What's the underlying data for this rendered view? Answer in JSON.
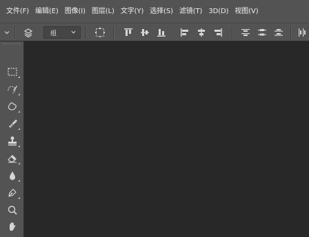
{
  "menubar": {
    "items": [
      {
        "label": "文件(F)"
      },
      {
        "label": "编辑(E)"
      },
      {
        "label": "图像(I)"
      },
      {
        "label": "图层(L)"
      },
      {
        "label": "文字(Y)"
      },
      {
        "label": "选择(S)"
      },
      {
        "label": "滤镜(T)"
      },
      {
        "label": "3D(D)"
      },
      {
        "label": "视图(V)"
      }
    ]
  },
  "options_bar": {
    "auto_select_target": {
      "value": "组"
    }
  },
  "toolbar": {
    "tools": [
      {
        "icon": "rectangular-marquee-icon"
      },
      {
        "icon": "quick-selection-icon"
      },
      {
        "icon": "spot-healing-brush-icon"
      },
      {
        "icon": "brush-icon"
      },
      {
        "icon": "clone-stamp-icon"
      },
      {
        "icon": "eraser-icon"
      },
      {
        "icon": "blur-icon"
      },
      {
        "icon": "pen-icon"
      },
      {
        "icon": "zoom-icon"
      },
      {
        "icon": "hand-icon"
      }
    ]
  },
  "colors": {
    "chrome": "#535353",
    "canvas_background": "#282828",
    "icon": "#d6d6d6"
  }
}
